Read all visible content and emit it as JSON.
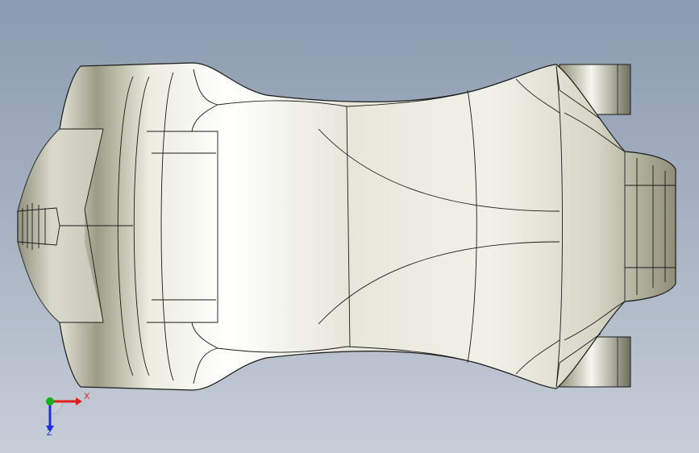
{
  "viewport": {
    "background": "#a3afc0"
  },
  "model": {
    "view": "top",
    "fill": "#e8e8dc",
    "edge_color": "#1a1a1a"
  },
  "triad": {
    "x_label": "X",
    "z_label": "Z",
    "x_color": "#e01e1e",
    "y_color": "#18b018",
    "z_color": "#1e2ee0"
  }
}
